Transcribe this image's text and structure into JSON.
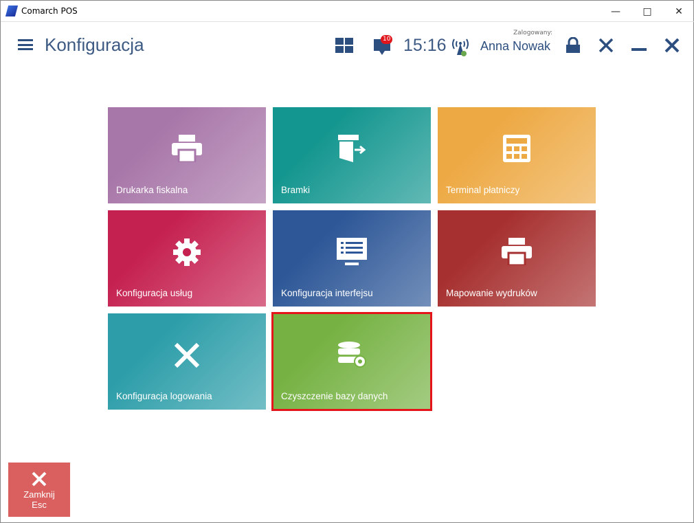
{
  "window": {
    "title": "Comarch POS"
  },
  "header": {
    "title": "Konfiguracja",
    "notifications": "10",
    "time": "15:16",
    "logged_label": "Zalogowany:",
    "user": "Anna Nowak"
  },
  "tiles": [
    {
      "label": "Drukarka fiskalna",
      "color": "#a877a9"
    },
    {
      "label": "Bramki",
      "color": "#13968f"
    },
    {
      "label": "Terminal płatniczy",
      "color": "#eda943"
    },
    {
      "label": "Konfiguracja usług",
      "color": "#c52150"
    },
    {
      "label": "Konfiguracja interfejsu",
      "color": "#2d5797"
    },
    {
      "label": "Mapowanie wydruków",
      "color": "#a6302f"
    },
    {
      "label": "Konfiguracja logowania",
      "color": "#2d9ea9"
    },
    {
      "label": "Czyszczenie bazy danych",
      "color": "#76b243",
      "selected": true
    }
  ],
  "close_button": {
    "label": "Zamknij",
    "shortcut": "Esc"
  }
}
